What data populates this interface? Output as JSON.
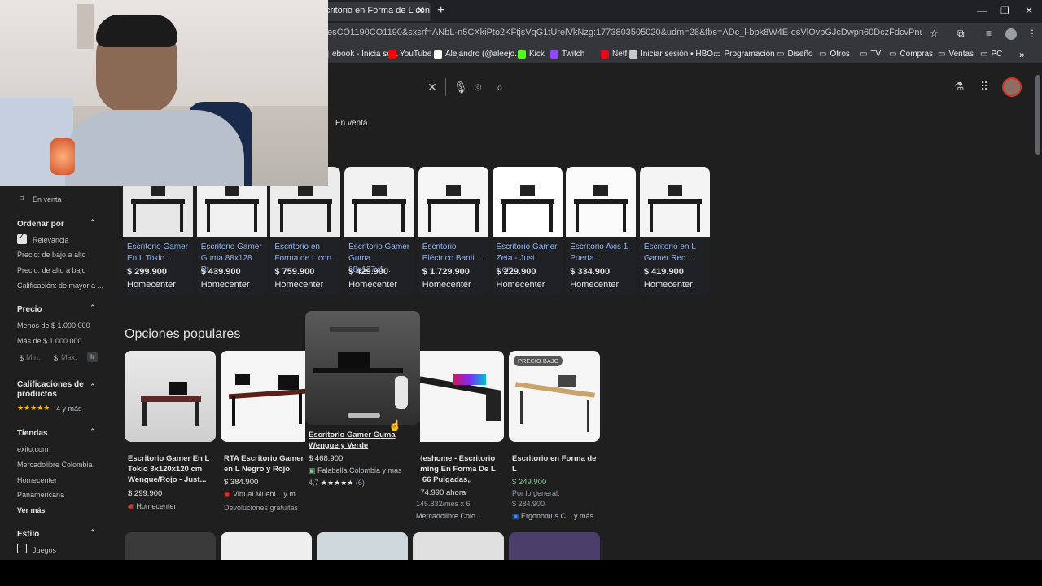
{
  "browser": {
    "tab_title": "critorio en Forma de L con Se",
    "url": "esCO1190CO1190&sxsrf=ANbL-n5CXkiPto2KFtjsVqG1tUrelVkNzg:1773803505020&udm=28&fbs=ADc_l-bpk8W4E-qsVlOvbGJcDwpn60DczFdcvPnuv8WQohHLTcTH442KskDyC7...",
    "bookmarks": [
      {
        "label": "ebook - Inicia se...",
        "color": "#1877f2"
      },
      {
        "label": "YouTube",
        "color": "#ff0000"
      },
      {
        "label": "Alejandro (@aleejo....",
        "color": "#ffffff"
      },
      {
        "label": "Kick",
        "color": "#53fc18"
      },
      {
        "label": "Twitch",
        "color": "#9146ff"
      },
      {
        "label": "Netflix",
        "color": "#e50914"
      },
      {
        "label": "Iniciar sesión • HBO...",
        "color": "#c8c8c8"
      },
      {
        "label": "Programación",
        "color": "#e8eaed"
      },
      {
        "label": "Diseño",
        "color": "#e8eaed"
      },
      {
        "label": "Otros",
        "color": "#e8eaed"
      },
      {
        "label": "TV",
        "color": "#e8eaed"
      },
      {
        "label": "Compras",
        "color": "#e8eaed"
      },
      {
        "label": "Ventas",
        "color": "#e8eaed"
      },
      {
        "label": "PC",
        "color": "#e8eaed"
      }
    ]
  },
  "filters": {
    "chip": "En venta"
  },
  "sidebar": {
    "en_venta": "En venta",
    "ordenar": {
      "title": "Ordenar por",
      "items": [
        "Relevancia",
        "Precio: de bajo a alto",
        "Precio: de alto a bajo",
        "Calificación: de mayor a ..."
      ]
    },
    "precio": {
      "title": "Precio",
      "items": [
        "Menos de $ 1.000.000",
        "Más de $ 1.000.000"
      ],
      "min_placeholder": "Mín.",
      "max_placeholder": "Máx.",
      "currency": "$",
      "go": "Ir"
    },
    "calificaciones": {
      "title": "Calificaciones de productos",
      "stars": "★★★★★",
      "label": "4 y más"
    },
    "tiendas": {
      "title": "Tiendas",
      "items": [
        "exito.com",
        "Mercadolibre Colombia",
        "Homecenter",
        "Panamericana"
      ],
      "more": "Ver más"
    },
    "estilo": {
      "title": "Estilo",
      "items": [
        "Juegos"
      ]
    }
  },
  "homecenter_cards": [
    {
      "title": "Escritorio Gamer En L Tokio...",
      "price": "$ 299.900",
      "store": "Homecenter"
    },
    {
      "title": "Escritorio Gamer Guma 88x128 Rt...",
      "price": "$ 439.900",
      "store": "Homecenter"
    },
    {
      "title": "Escritorio en Forma de L con...",
      "price": "$ 759.900",
      "store": "Homecenter"
    },
    {
      "title": "Escritorio Gamer Guma 88x127x1...",
      "price": "$ 429.900",
      "store": "Homecenter"
    },
    {
      "title": "Escritorio Eléctrico Banti ...",
      "price": "$ 1.729.900",
      "store": "Homecenter"
    },
    {
      "title": "Escritorio Gamer Zeta - Just Hom...",
      "price": "$ 229.900",
      "store": "Homecenter"
    },
    {
      "title": "Escritorio Axis 1 Puerta...",
      "price": "$ 334.900",
      "store": "Homecenter"
    },
    {
      "title": "Escritorio en L Gamer Red...",
      "price": "$ 419.900",
      "store": "Homecenter"
    }
  ],
  "popular": {
    "title": "Opciones populares",
    "items": [
      {
        "title": "Escritorio Gamer En L Tokio 3x120x120 cm Wengue/Rojo - Just...",
        "price": "$ 299.900",
        "store": "Homecenter"
      },
      {
        "title": "RTA Escritorio Gamer en L Negro y Rojo",
        "price": "$ 384.900",
        "store": "Virtual Muebl... y m",
        "extra": "Devoluciones gratuitas"
      },
      {
        "title": "Escritorio Gamer Guma Wengue y Verde",
        "price": "$ 468.900",
        "store": "Falabella Colombia y más",
        "rating": "4,7",
        "stars": "★★★★★",
        "reviews": "(6)"
      },
      {
        "title": "bleshome - Escritorio aming En Forma De L e 66 Pulgadas,.",
        "price": "374.990 ahora",
        "installment": "145.832/mes x 6",
        "store": "Mercadolibre Colo..."
      },
      {
        "badge": "PRECIO BAJO",
        "title": "Escritorio en Forma de L",
        "price": "$ 249.900",
        "note": "Por lo general,",
        "old_price": "$ 284.900",
        "store": "Ergonomus C... y más"
      }
    ]
  }
}
